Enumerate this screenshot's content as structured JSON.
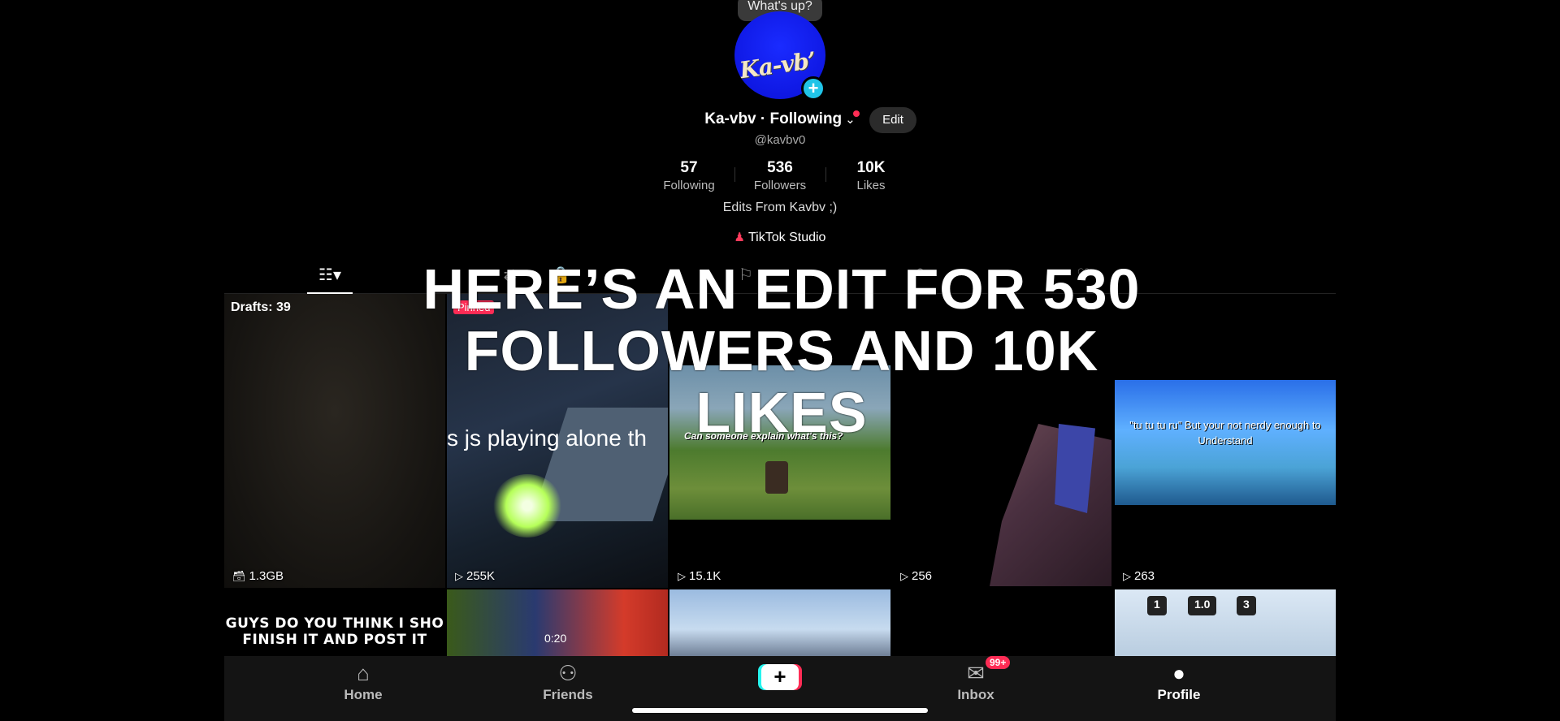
{
  "profile": {
    "status_tooltip": "What's up?",
    "avatar_text": "Ka-vb’",
    "display_name": "Ka-vbv · Following",
    "edit_label": "Edit",
    "handle": "@kavbv0",
    "stats": [
      {
        "value": "57",
        "label": "Following"
      },
      {
        "value": "536",
        "label": "Followers"
      },
      {
        "value": "10K",
        "label": "Likes"
      }
    ],
    "bio": "Edits From Kavbv ;)",
    "studio_label": "TikTok Studio"
  },
  "caption_overlay": "HERE’S AN EDIT FOR 530 FOLLOWERS AND 10K LIKES",
  "grid": {
    "drafts": {
      "label": "Drafts: 39",
      "size": "1.3GB"
    },
    "videos": [
      {
        "pinned_label": "Pinned",
        "overlay_text": "s js playing alone th",
        "views": "255K"
      },
      {
        "overlay_text": "Can someone explain what's this?",
        "views": "15.1K"
      },
      {
        "views": "256"
      },
      {
        "overlay_text": "\"tu tu tu ru\" But your not nerdy enough to Understand",
        "views": "263"
      }
    ],
    "row2": {
      "r1_text": "GUYS DO YOU THINK I SHO FINISH IT AND POST IT",
      "r2_time": "0:20",
      "r5_chips": [
        "1",
        "1.0",
        "3"
      ]
    }
  },
  "nav": {
    "home": "Home",
    "friends": "Friends",
    "create": "+",
    "inbox": "Inbox",
    "inbox_badge": "99+",
    "profile": "Profile"
  }
}
